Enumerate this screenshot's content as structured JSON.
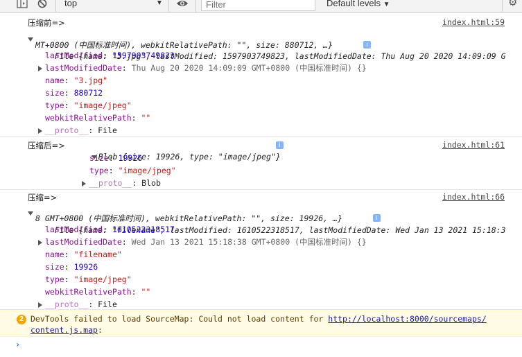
{
  "toolbar": {
    "context": "top",
    "filter_placeholder": "Filter",
    "levels": "Default levels"
  },
  "messages": [
    {
      "label": "压缩前=>",
      "source": "index.html:59",
      "summary1": "File {name: \"3.jpg\", lastModified: 1597903749823, lastModifiedDate: Thu Aug 20 2020 14:09:09 G",
      "summary2": "MT+0800 (中国标准时间), webkitRelativePath: \"\", size: 880712, …}",
      "props": [
        {
          "key": "lastModified",
          "value": "1597903749823",
          "kind": "num"
        },
        {
          "key": "lastModifiedDate",
          "value": "Thu Aug 20 2020 14:09:09 GMT+0800 (中国标准时间) {}",
          "kind": "gray",
          "expandable": true
        },
        {
          "key": "name",
          "value": "\"3.jpg\"",
          "kind": "str"
        },
        {
          "key": "size",
          "value": "880712",
          "kind": "num"
        },
        {
          "key": "type",
          "value": "\"image/jpeg\"",
          "kind": "str"
        },
        {
          "key": "webkitRelativePath",
          "value": "\"\"",
          "kind": "str"
        },
        {
          "key": "__proto__",
          "value": "File",
          "kind": "plain",
          "expandable": true
        }
      ]
    },
    {
      "label": "压缩后=>",
      "source": "index.html:61",
      "summary1": "Blob {size: 19926, type: \"image/jpeg\"}",
      "props": [
        {
          "key": "size",
          "value": "19926",
          "kind": "num"
        },
        {
          "key": "type",
          "value": "\"image/jpeg\"",
          "kind": "str"
        },
        {
          "key": "__proto__",
          "value": "Blob",
          "kind": "plain",
          "expandable": true
        }
      ]
    },
    {
      "label": "压缩=>",
      "source": "index.html:66",
      "summary1": "File {name: \"filename\", lastModified: 1610522318517, lastModifiedDate: Wed Jan 13 2021 15:18:3",
      "summary2": "8 GMT+0800 (中国标准时间), webkitRelativePath: \"\", size: 19926, …}",
      "props": [
        {
          "key": "lastModified",
          "value": "1610522318517",
          "kind": "num"
        },
        {
          "key": "lastModifiedDate",
          "value": "Wed Jan 13 2021 15:18:38 GMT+0800 (中国标准时间) {}",
          "kind": "gray",
          "expandable": true
        },
        {
          "key": "name",
          "value": "\"filename\"",
          "kind": "str"
        },
        {
          "key": "size",
          "value": "19926",
          "kind": "num"
        },
        {
          "key": "type",
          "value": "\"image/jpeg\"",
          "kind": "str"
        },
        {
          "key": "webkitRelativePath",
          "value": "\"\"",
          "kind": "str"
        },
        {
          "key": "__proto__",
          "value": "File",
          "kind": "plain",
          "expandable": true
        }
      ]
    }
  ],
  "warning": {
    "count": "2",
    "text": "DevTools failed to load SourceMap: Could not load content for ",
    "url1": "http://localhost:8000/sourcemaps/",
    "url2": "content.js.map",
    "tail": ":"
  },
  "prompt": "›"
}
